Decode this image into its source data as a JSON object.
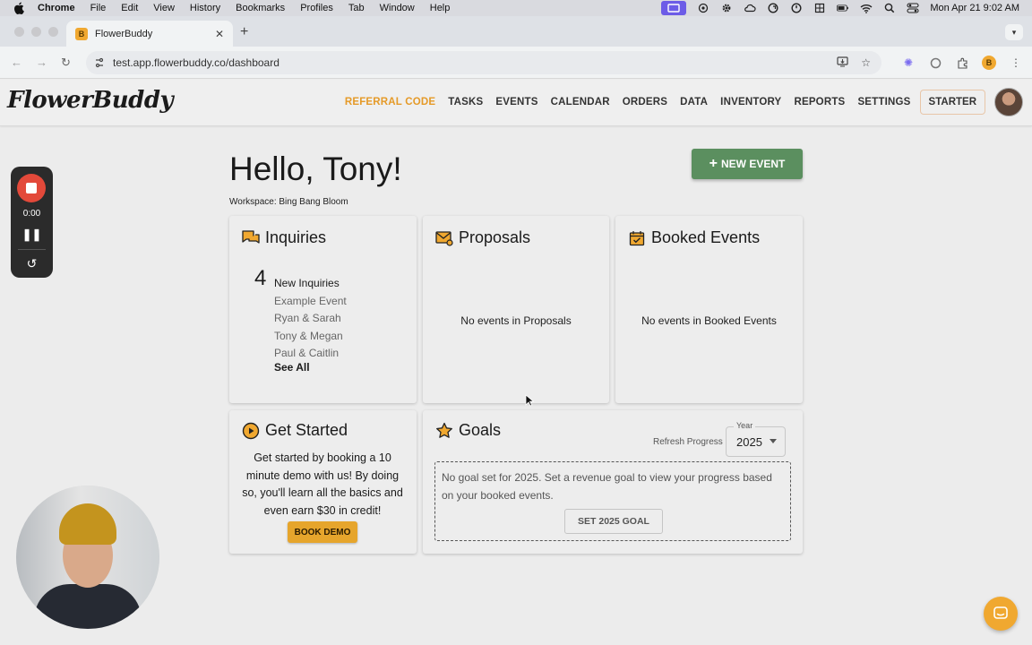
{
  "os_menubar": {
    "app": "Chrome",
    "menus": [
      "File",
      "Edit",
      "View",
      "History",
      "Bookmarks",
      "Profiles",
      "Tab",
      "Window",
      "Help"
    ],
    "clock": "Mon Apr 21  9:02 AM"
  },
  "browser": {
    "tab_title": "FlowerBuddy",
    "tab_favicon": "B",
    "url": "test.app.flowerbuddy.co/dashboard"
  },
  "app": {
    "logo": "FlowerBuddy",
    "nav": [
      {
        "label": "REFERRAL CODE"
      },
      {
        "label": "TASKS"
      },
      {
        "label": "EVENTS"
      },
      {
        "label": "CALENDAR"
      },
      {
        "label": "ORDERS"
      },
      {
        "label": "DATA"
      },
      {
        "label": "INVENTORY"
      },
      {
        "label": "REPORTS"
      },
      {
        "label": "SETTINGS"
      }
    ],
    "plan_label": "STARTER",
    "accent_color": "#e59a28",
    "primary_color": "#5b8f5f"
  },
  "recorder": {
    "time": "0:00"
  },
  "dashboard": {
    "greeting": "Hello, Tony!",
    "workspace": "Workspace: Bing Bang Bloom",
    "new_event_label": "NEW EVENT",
    "inquiries": {
      "title": "Inquiries",
      "count": "4",
      "count_label": "New Inquiries",
      "items": [
        "Example Event",
        "Ryan & Sarah",
        "Tony & Megan",
        "Paul & Caitlin"
      ],
      "see_all": "See All"
    },
    "proposals": {
      "title": "Proposals",
      "empty": "No events in Proposals"
    },
    "booked": {
      "title": "Booked Events",
      "empty": "No events in Booked Events"
    },
    "get_started": {
      "title": "Get Started",
      "text": "Get started by booking a 10 minute demo with us! By doing so, you'll learn all the basics and even earn $30 in credit!",
      "button": "BOOK DEMO"
    },
    "goals": {
      "title": "Goals",
      "refresh": "Refresh Progress",
      "year_label": "Year",
      "year_value": "2025",
      "message": "No goal set for 2025. Set a revenue goal to view your progress based on your booked events.",
      "button": "SET 2025 GOAL"
    }
  }
}
